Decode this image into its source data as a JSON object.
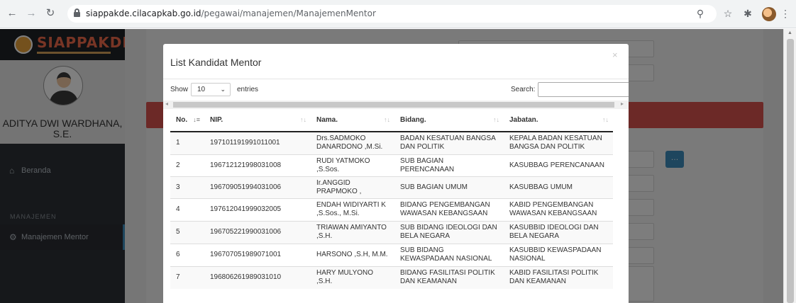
{
  "browser": {
    "url_host": "siappakde.cilacapkab.go.id",
    "url_path": "/pegawai/manajemen/ManajemenMentor"
  },
  "sidebar": {
    "user_name": "ADITYA DWI WARDHANA, S.E.",
    "menu_home": "Beranda",
    "section_label": "MANAJEMEN",
    "menu_mentor": "Manajemen Mentor"
  },
  "modal": {
    "title": "List Kandidat Mentor",
    "close": "×",
    "show_label": "Show",
    "length_value": "10",
    "entries_label": "entries",
    "search_label": "Search:",
    "search_value": ""
  },
  "table": {
    "columns": [
      "No.",
      "NIP.",
      "Nama.",
      "Bidang.",
      "Jabatan."
    ],
    "rows": [
      {
        "no": "1",
        "nip": "197101191991011001",
        "nama": "Drs.SADMOKO DANARDONO ,M.Si.",
        "bidang": "BADAN KESATUAN BANGSA DAN POLITIK",
        "jabatan": "KEPALA BADAN KESATUAN BANGSA DAN POLITIK"
      },
      {
        "no": "2",
        "nip": "196712121998031008",
        "nama": "RUDI YATMOKO ,S.Sos.",
        "bidang": "SUB BAGIAN PERENCANAAN",
        "jabatan": "KASUBBAG PERENCANAAN"
      },
      {
        "no": "3",
        "nip": "196709051994031006",
        "nama": "Ir.ANGGID PRAPMOKO ,",
        "bidang": "SUB BAGIAN UMUM",
        "jabatan": "KASUBBAG UMUM"
      },
      {
        "no": "4",
        "nip": "197612041999032005",
        "nama": "ENDAH WIDIYARTI K ,S.Sos., M.Si.",
        "bidang": "BIDANG PENGEMBANGAN WAWASAN KEBANGSAAN",
        "jabatan": "KABID PENGEMBANGAN WAWASAN KEBANGSAAN"
      },
      {
        "no": "5",
        "nip": "196705221990031006",
        "nama": "TRIAWAN AMIYANTO ,S.H.",
        "bidang": "SUB BIDANG IDEOLOGI DAN BELA NEGARA",
        "jabatan": "KASUBBID IDEOLOGI DAN BELA NEGARA"
      },
      {
        "no": "6",
        "nip": "196707051989071001",
        "nama": "HARSONO ,S.H, M.M.",
        "bidang": "SUB BIDANG KEWASPADAAN NASIONAL",
        "jabatan": "KASUBBID KEWASPADAAN NASIONAL"
      },
      {
        "no": "7",
        "nip": "196806261989031010",
        "nama": "HARY MULYONO ,S.H.",
        "bidang": "BIDANG FASILITASI POLITIK DAN KEAMANAN",
        "jabatan": "KABID FASILITASI POLITIK DAN KEAMANAN"
      }
    ]
  }
}
